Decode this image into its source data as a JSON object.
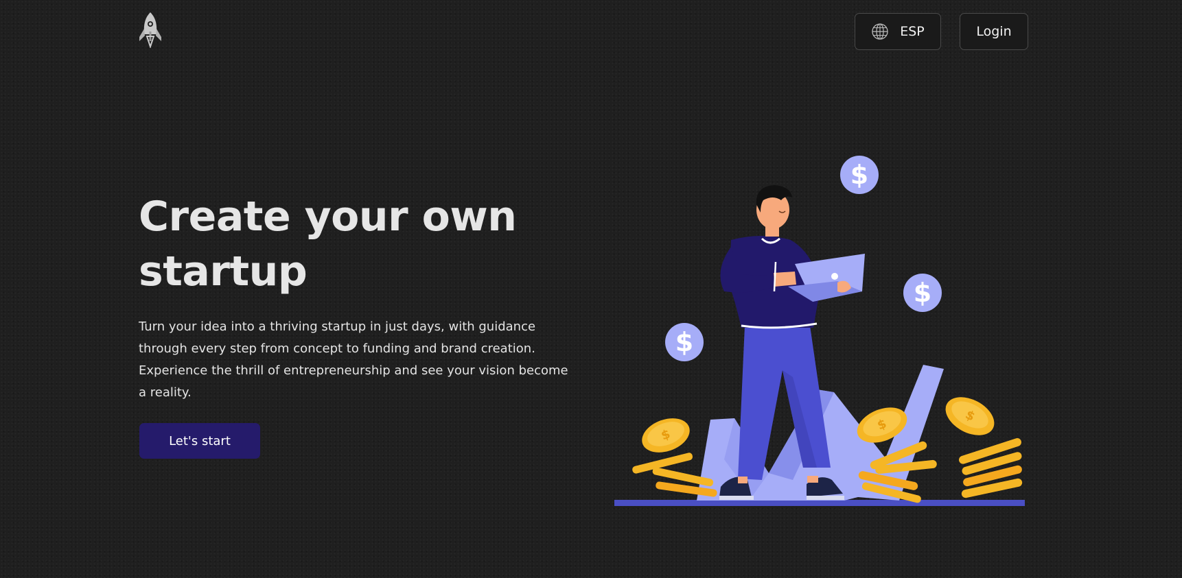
{
  "header": {
    "logo_icon": "rocket-icon",
    "language_button": {
      "icon": "globe-icon",
      "label": "ESP"
    },
    "login_label": "Login"
  },
  "hero": {
    "title": "Create your own startup",
    "description": "Turn your idea into a thriving startup in just days, with guidance through every step from concept to funding and brand creation. Experience the thrill of entrepreneurship and see your vision become a reality.",
    "cta_label": "Let's start",
    "illustration": "person-with-laptop-and-coins-illustration"
  },
  "colors": {
    "background": "#1f1f1f",
    "cta": "#251b6b",
    "accent_periwinkle": "#a5acf7",
    "accent_indigo": "#3f45b5",
    "coin_gold": "#f5b625"
  }
}
